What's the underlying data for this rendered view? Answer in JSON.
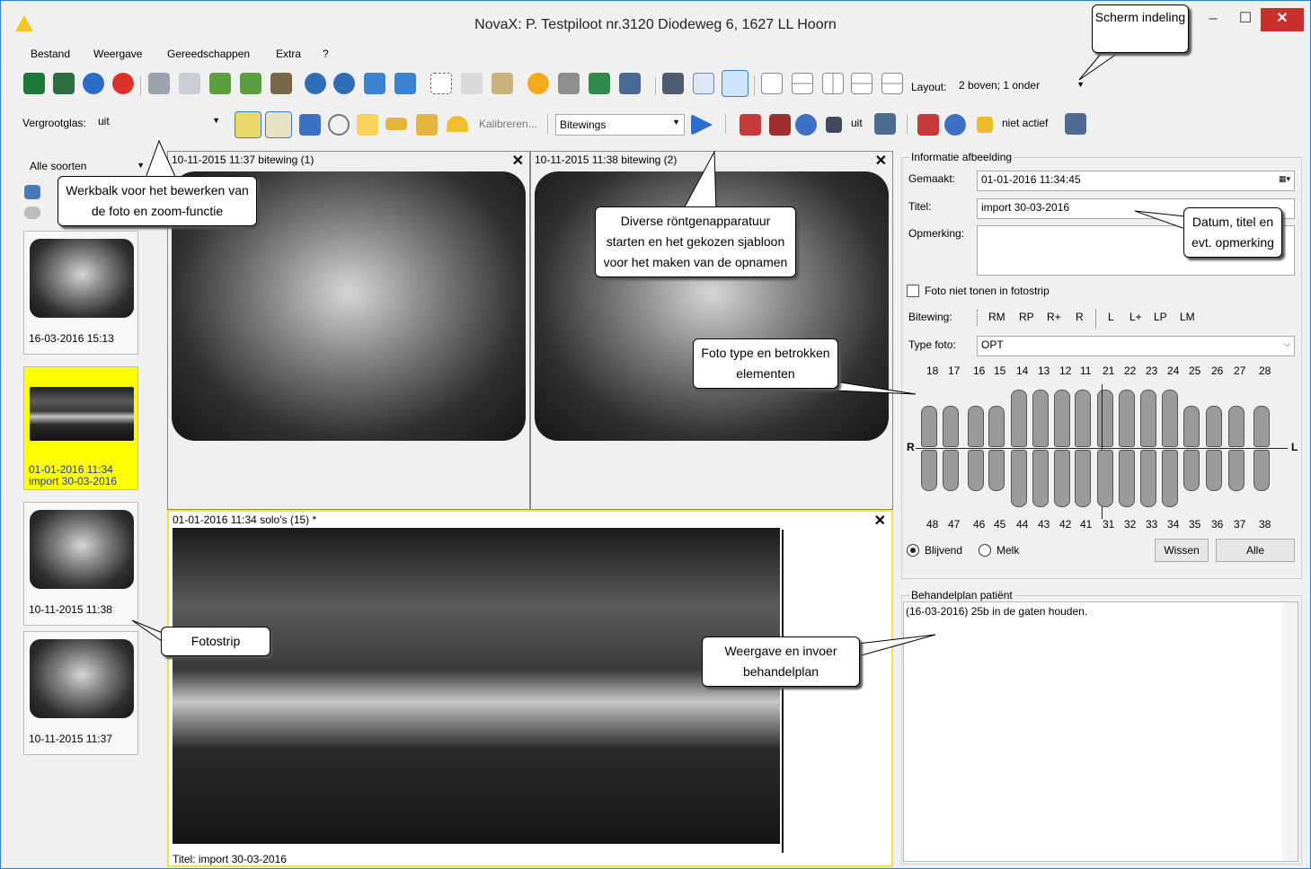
{
  "window": {
    "title": "NovaX: P. Testpiloot nr.3120 Diodeweg 6, 1627 LL Hoorn",
    "min": "–",
    "max": "☐",
    "close": "✕"
  },
  "menu": [
    "Bestand",
    "Weergave",
    "Gereedschappen",
    "Extra",
    "?"
  ],
  "toolbar1": {
    "layout_label": "Layout:",
    "layout_value": "2 boven; 1 onder"
  },
  "toolbar2": {
    "zoom_label": "Vergrootglas:",
    "zoom_value": "uit",
    "calibrate": "Kalibreren...",
    "template_value": "Bitewings",
    "status1": "uit",
    "status2": "niet actief"
  },
  "filter": {
    "value": "Alle soorten"
  },
  "fotostrip": [
    {
      "date": "16-03-2016 15:13",
      "title": ""
    },
    {
      "date": "01-01-2016 11:34",
      "title": "import 30-03-2016",
      "selected": true
    },
    {
      "date": "10-11-2015 11:38",
      "title": ""
    },
    {
      "date": "10-11-2015 11:37",
      "title": ""
    }
  ],
  "panes": {
    "top_left": "10-11-2015 11:37 bitewing (1)",
    "top_right": "10-11-2015 11:38 bitewing (2)",
    "bottom": "01-01-2016 11:34 solo's (15) *",
    "bottom_caption": "Titel: import 30-03-2016",
    "close": "✕"
  },
  "info": {
    "group_title": "Informatie afbeelding",
    "made_label": "Gemaakt:",
    "made_value": "01-01-2016 11:34:45",
    "title_label": "Titel:",
    "title_value": "import 30-03-2016",
    "remark_label": "Opmerking:",
    "remark_value": "",
    "hide_checkbox": "Foto niet tonen in fotostrip",
    "bitewing_label": "Bitewing:",
    "bitewing_options": [
      "RM",
      "RP",
      "R+",
      "R",
      "L",
      "L+",
      "LP",
      "LM"
    ],
    "type_label": "Type foto:",
    "type_value": "OPT",
    "upper_teeth": [
      "18",
      "17",
      "16",
      "15",
      "14",
      "13",
      "12",
      "11",
      "21",
      "22",
      "23",
      "24",
      "25",
      "26",
      "27",
      "28"
    ],
    "lower_teeth": [
      "48",
      "47",
      "46",
      "45",
      "44",
      "43",
      "42",
      "41",
      "31",
      "32",
      "33",
      "34",
      "35",
      "36",
      "37",
      "38"
    ],
    "side_left": "R",
    "side_right": "L",
    "radio1": "Blijvend",
    "radio2": "Melk",
    "clear_btn": "Wissen",
    "all_btn": "Alle"
  },
  "treatment": {
    "group_title": "Behandelplan patiënt",
    "text": "(16-03-2016) 25b in de gaten houden."
  },
  "callouts": {
    "screen": "Scherm indeling",
    "toolbar": "Werkbalk voor het bewerken van de foto en zoom-functie",
    "xray": "Diverse röntgenapparatuur starten en het gekozen sjabloon voor het maken van de opnamen",
    "date": "Datum, titel en evt. opmerking",
    "phototype": "Foto type en betrokken elementen",
    "strip": "Fotostrip",
    "plan": "Weergave en invoer behandelplan"
  }
}
